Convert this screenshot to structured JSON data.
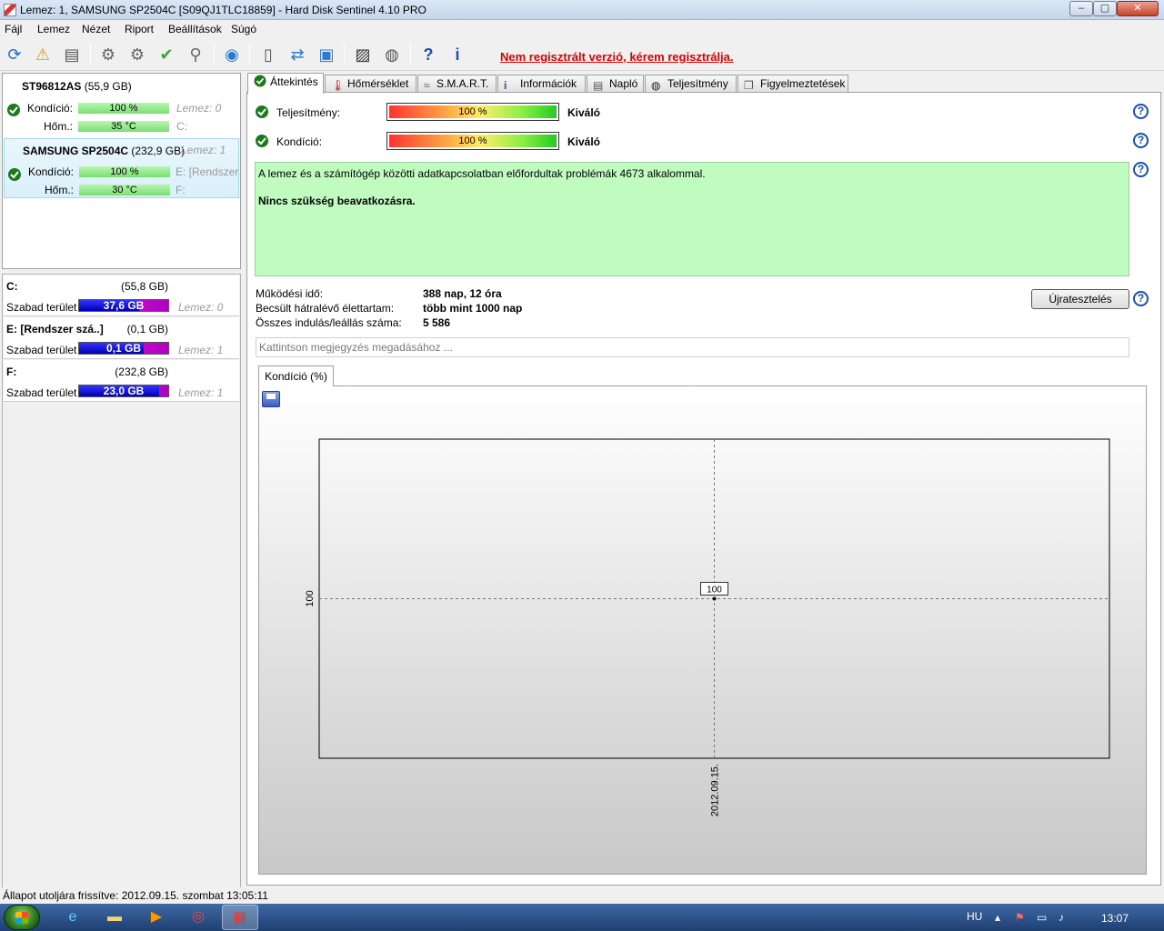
{
  "window": {
    "title": "Lemez: 1, SAMSUNG SP2504C [S09QJ1TLC18859]  -  Hard Disk Sentinel 4.10 PRO",
    "min": "–",
    "max": "▢",
    "close": "✕"
  },
  "menu": [
    "Fájl",
    "Lemez",
    "Nézet",
    "Riport",
    "Beállítások",
    "Súgó"
  ],
  "toolbar": {
    "register_text": "Nem regisztrált verzió, kérem regisztrálja."
  },
  "disks": [
    {
      "name": "ST96812AS",
      "size": "(55,9 GB)",
      "cond_label": "Kondíció:",
      "cond": "100 %",
      "cond_level": 1.0,
      "temp_label": "Hőm.:",
      "temp": "35 °C",
      "disk_ref": "Lemez: 0",
      "vols": "C:"
    },
    {
      "name": "SAMSUNG SP2504C",
      "size": "(232,9 GB)",
      "disk_ref": "Lemez: 1",
      "cond_label": "Kondíció:",
      "cond": "100 %",
      "cond_level": 1.0,
      "temp_label": "Hőm.:",
      "temp": "30 °C",
      "vols": "E: [Rendszer s",
      "vols2": "F:"
    }
  ],
  "volumes": [
    {
      "name": "C:",
      "size": "(55,8 GB)",
      "free_label": "Szabad terület",
      "free": "37,6 GB",
      "free_frac": 0.67,
      "disk": "Lemez: 0"
    },
    {
      "name": "E: [Rendszer szá..]",
      "size": "(0,1 GB)",
      "free_label": "Szabad terület",
      "free": "0,1 GB",
      "free_frac": 0.72,
      "disk": "Lemez: 1"
    },
    {
      "name": "F:",
      "size": "(232,8 GB)",
      "free_label": "Szabad terület",
      "free": "23,0 GB",
      "free_frac": 0.9,
      "disk": "Lemez: 1"
    }
  ],
  "tabs": [
    "Áttekintés",
    "Hőmérséklet",
    "S.M.A.R.T.",
    "Információk",
    "Napló",
    "Teljesítmény",
    "Figyelmeztetések"
  ],
  "overview": {
    "perf_label": "Teljesítmény:",
    "perf_value": "100 %",
    "perf_level": 1.0,
    "perf_quality": "Kiváló",
    "cond_label": "Kondíció:",
    "cond_value": "100 %",
    "cond_level": 1.0,
    "cond_quality": "Kiváló",
    "message1": "A lemez és a számítógép közötti adatkapcsolatban előfordultak problémák 4673 alkalommal.",
    "message2": "Nincs szükség beavatkozásra.",
    "uptime_label": "Működési idő:",
    "uptime": "388 nap, 12 óra",
    "remaining_label": "Becsült hátralévő élettartam:",
    "remaining": "több mint 1000 nap",
    "startstop_label": "Összes indulás/leállás száma:",
    "startstop": "5 586",
    "retest_button": "Újratesztelés",
    "note_placeholder": "Kattintson megjegyzés megadásához ...",
    "help": "?"
  },
  "graph": {
    "tab_label": "Kondíció  (%)"
  },
  "chart_data": {
    "type": "line",
    "x": [
      "2012.09.15."
    ],
    "series": [
      {
        "values": [
          100
        ]
      }
    ],
    "ylabel": "",
    "xlabel": "",
    "y_tick_labels": [
      "100"
    ],
    "x_tick_labels": [
      "2012.09.15."
    ],
    "data_labels": [
      "100"
    ]
  },
  "statusbar": {
    "text": "Állapot utoljára frissítve: 2012.09.15. szombat 13:05:11"
  },
  "taskbar": {
    "lang": "HU",
    "clock": "13:07"
  }
}
